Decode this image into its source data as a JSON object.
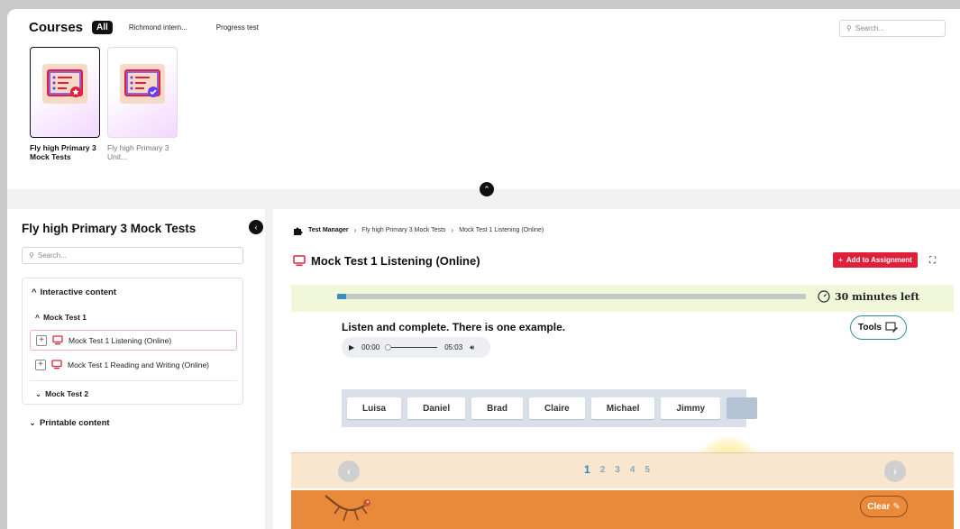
{
  "courses": {
    "title": "Courses",
    "filter_all": "All",
    "tabs": [
      "Richmond intern...",
      "Progress test"
    ],
    "search_placeholder": "Search...",
    "cards": [
      {
        "title": "Fly high Primary 3 Mock Tests",
        "selected": true
      },
      {
        "title": "Fly high Primary 3 Unit...",
        "selected": false
      }
    ]
  },
  "sidebar": {
    "title": "Fly high Primary 3 Mock Tests",
    "search_placeholder": "Search...",
    "section_interactive": "Interactive content",
    "group1": "Mock Test 1",
    "items": [
      {
        "label": "Mock Test 1 Listening (Online)",
        "active": true
      },
      {
        "label": "Mock Test 1 Reading and Writing (Online)",
        "active": false
      }
    ],
    "group2": "Mock Test 2",
    "section_printable": "Printable content"
  },
  "main": {
    "breadcrumb": [
      "Test Manager",
      "Fly high Primary 3 Mock Tests",
      "Mock Test 1 Listening (Online)"
    ],
    "title": "Mock Test 1 Listening (Online)",
    "add_button": "Add to Assignment",
    "progress_fraction": 0.02,
    "timer": "30 minutes left",
    "instruction": "Listen and complete. There is one example.",
    "tools_label": "Tools",
    "audio": {
      "current": "00:00",
      "duration": "05:03"
    },
    "words": [
      "Luisa",
      "Daniel",
      "Brad",
      "Claire",
      "Michael",
      "Jimmy"
    ],
    "pages": [
      "1",
      "2",
      "3",
      "4",
      "5"
    ],
    "current_page": "1",
    "clear_label": "Clear"
  },
  "colors": {
    "accent_red": "#e0203a",
    "progress_blue": "#3b8dbd",
    "teal_border": "#2d8a9c",
    "orange_band": "#e88a3a",
    "peach_band": "#f9e6cf",
    "progress_band": "#f0f8d9"
  }
}
